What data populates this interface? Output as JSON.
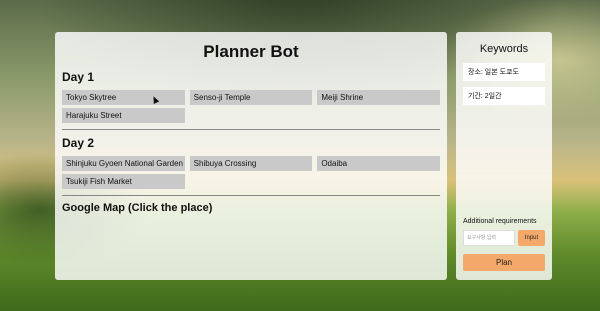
{
  "main": {
    "title": "Planner Bot",
    "days": [
      {
        "label": "Day 1",
        "places": [
          "Tokyo Skytree",
          "Senso-ji Temple",
          "Meiji Shrine",
          "Harajuku Street"
        ]
      },
      {
        "label": "Day 2",
        "places": [
          "Shinjuku Gyoen National Garden",
          "Shibuya Crossing",
          "Odaiba",
          "Tsukiji Fish Market"
        ]
      }
    ],
    "map_heading": "Google Map (Click the place)"
  },
  "side": {
    "title": "Keywords",
    "keywords": [
      "장소: 일본 도쿄도",
      "기간: 2일간"
    ],
    "requirements_label": "Additional requirements",
    "requirements_placeholder": "요구사항 입력",
    "input_button": "Input",
    "plan_button": "Plan"
  },
  "colors": {
    "accent": "#f4a96a",
    "place_bg": "#c9c9c9"
  }
}
